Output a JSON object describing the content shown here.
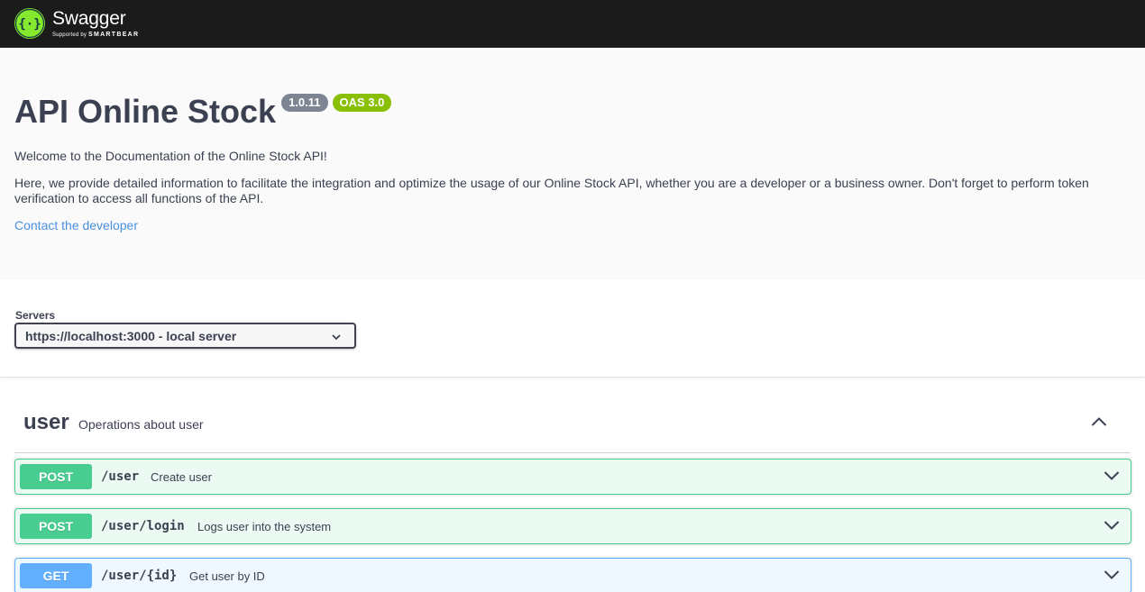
{
  "topbar": {
    "brand_name": "Swagger",
    "brand_sub_prefix": "Supported by",
    "brand_sub_company": "SMARTBEAR",
    "logo_color": "#85ea2d",
    "background": "#1b1b1b"
  },
  "info": {
    "title": "API Online Stock",
    "version_badge": "1.0.11",
    "oas_badge": "OAS 3.0",
    "description_1": "Welcome to the Documentation of the Online Stock API!",
    "description_2": "Here, we provide detailed information to facilitate the integration and optimize the usage of our Online Stock API, whether you are a developer or a business owner. Don't forget to perform token verification to access all functions of the API.",
    "contact_link": "Contact the developer"
  },
  "servers": {
    "label": "Servers",
    "selected": "https://localhost:3000 - local server"
  },
  "tag": {
    "name": "user",
    "description": "Operations about user",
    "expanded": true
  },
  "operations": [
    {
      "method": "POST",
      "path": "/user",
      "summary": "Create user"
    },
    {
      "method": "POST",
      "path": "/user/login",
      "summary": "Logs user into the system"
    },
    {
      "method": "GET",
      "path": "/user/{id}",
      "summary": "Get user by ID"
    }
  ],
  "colors": {
    "post": "#49cc90",
    "get": "#61affe",
    "version_badge": "#7d8492",
    "oas_badge": "#89bf04",
    "link": "#4990e2"
  }
}
